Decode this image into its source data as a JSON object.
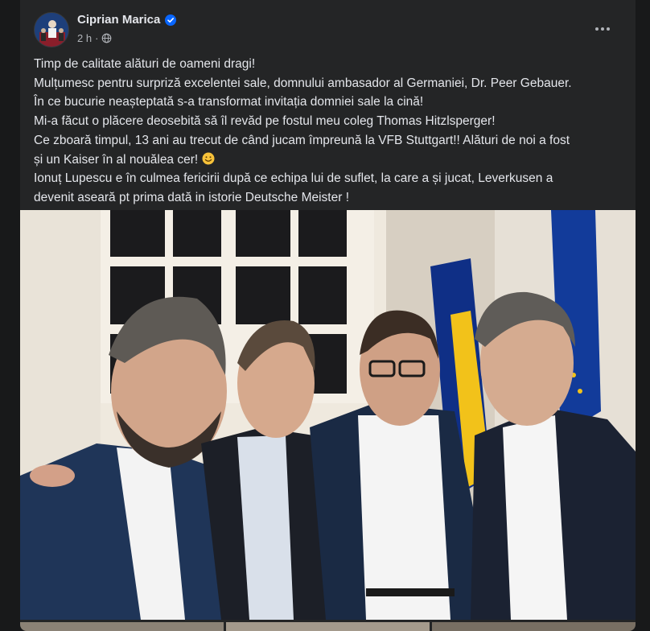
{
  "post": {
    "author": "Ciprian Marica",
    "time": "2 h",
    "separator": "·",
    "lines": [
      "Timp de calitate alături de oameni dragi!",
      "Mulțumesc pentru surpriză excelentei sale, domnului ambasador al Germaniei, Dr. Peer Gebauer.",
      "În ce bucurie neașteptată s-a transformat invitația domniei sale la cină!",
      " Mi-a făcut o plăcere deosebită să îl revăd pe fostul meu coleg Thomas Hitzlsperger!",
      "Ce zboară timpul, 13 ani au trecut de când jucam împreună la VFB Stuttgart!! Alături de noi a fost",
      "și un  Kaiser în al nouălea cer!",
      "Ionuț Lupescu e în culmea fericirii după ce echipa lui de suflet, la care a și jucat,  Leverkusen a",
      "devenit aseară pt prima dată in istorie Deutsche Meister !"
    ]
  },
  "icons": {
    "verified": "verified-badge-icon",
    "audience": "globe-icon",
    "more": "more-options-icon",
    "emoji": "smiling-face-emoji"
  },
  "colors": {
    "page_bg": "#18191a",
    "card_bg": "#242526",
    "text_primary": "#e4e6eb",
    "text_secondary": "#b0b3b8",
    "verified_blue": "#0866ff"
  }
}
